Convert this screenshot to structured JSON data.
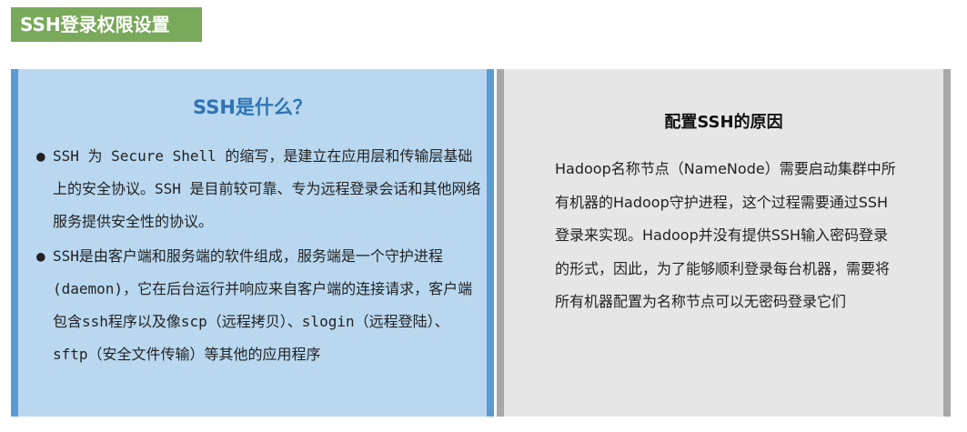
{
  "header": {
    "title": "SSH登录权限设置"
  },
  "left": {
    "heading": "SSH是什么？",
    "bullets": [
      "SSH 为 Secure Shell 的缩写，是建立在应用层和传输层基础上的安全协议。SSH 是目前较可靠、专为远程登录会话和其他网络服务提供安全性的协议。",
      "SSH是由客户端和服务端的软件组成，服务端是一个守护进程(daemon)，它在后台运行并响应来自客户端的连接请求，客户端包含ssh程序以及像scp（远程拷贝）、slogin（远程登陆）、sftp（安全文件传输）等其他的应用程序"
    ]
  },
  "right": {
    "heading": "配置SSH的原因",
    "body": "Hadoop名称节点（NameNode）需要启动集群中所有机器的Hadoop守护进程，这个过程需要通过SSH登录来实现。Hadoop并没有提供SSH输入密码登录的形式，因此，为了能够顺利登录每台机器，需要将所有机器配置为名称节点可以无密码登录它们"
  },
  "colors": {
    "header_bg": "#79a95a",
    "left_bg": "#b9d8f0",
    "left_accent": "#5b9bd5",
    "left_heading": "#2e74b5",
    "right_bg": "#e6e6e6",
    "right_accent": "#a8a8a8"
  }
}
